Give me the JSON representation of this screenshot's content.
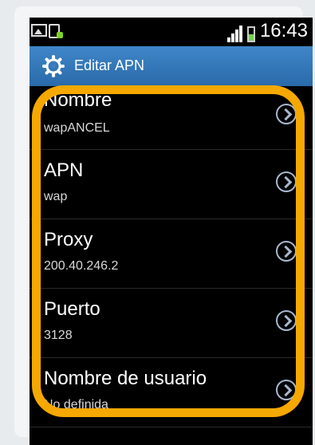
{
  "status_bar": {
    "time": "16:43"
  },
  "header": {
    "title": "Editar APN",
    "icon": "gear-icon"
  },
  "rows": [
    {
      "label": "Nombre",
      "value": "wapANCEL"
    },
    {
      "label": "APN",
      "value": "wap"
    },
    {
      "label": "Proxy",
      "value": "200.40.246.2"
    },
    {
      "label": "Puerto",
      "value": "3128"
    },
    {
      "label": "Nombre de usuario",
      "value": "No definida"
    }
  ],
  "colors": {
    "titlebar": "#3a7fc3",
    "highlight": "#f5a800",
    "background": "#000000"
  }
}
